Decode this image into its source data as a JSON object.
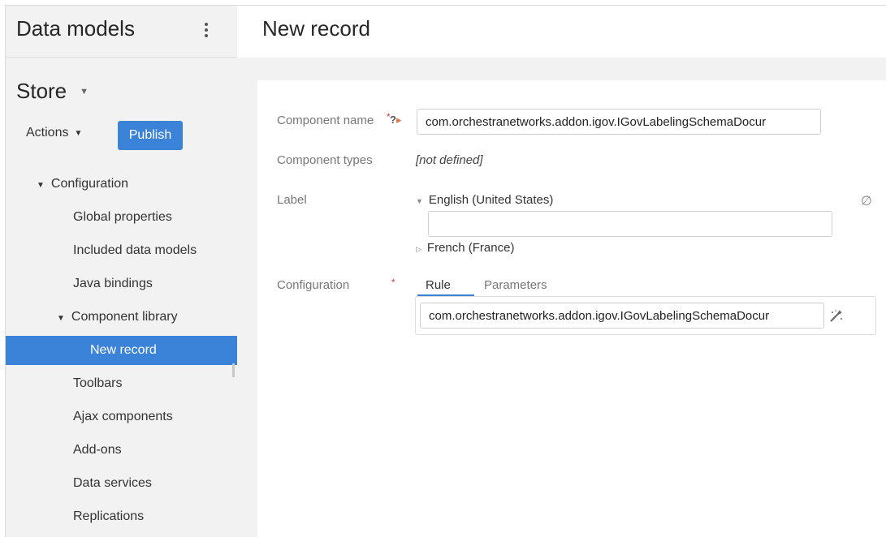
{
  "sidebar": {
    "title": "Data models",
    "store": "Store",
    "actions_label": "Actions",
    "publish_label": "Publish",
    "tree": {
      "configuration": "Configuration",
      "global_properties": "Global properties",
      "included_data_models": "Included data models",
      "java_bindings": "Java bindings",
      "component_library": "Component library",
      "new_record": "New record",
      "toolbars": "Toolbars",
      "ajax_components": "Ajax components",
      "add_ons": "Add-ons",
      "data_services": "Data services",
      "replications": "Replications"
    }
  },
  "main": {
    "title": "New record",
    "form": {
      "component_name_label": "Component name",
      "component_name_value": "com.orchestranetworks.addon.igov.IGovLabelingSchemaDocur",
      "component_types_label": "Component types",
      "component_types_value": "[not defined]",
      "label_label": "Label",
      "lang_english": "English (United States)",
      "lang_french": "French (France)",
      "configuration_label": "Configuration",
      "tab_rule": "Rule",
      "tab_parameters": "Parameters",
      "rule_value": "com.orchestranetworks.addon.igov.IGovLabelingSchemaDocur"
    }
  },
  "colors": {
    "accent": "#3b82d9",
    "sidebar_bg": "#f2f2f2",
    "required": "#d83a3a"
  },
  "icons": {
    "kebab": "more-vertical-icon",
    "help": "help-icon",
    "clear": "empty-set-icon",
    "wizard": "magic-wand-icon"
  }
}
